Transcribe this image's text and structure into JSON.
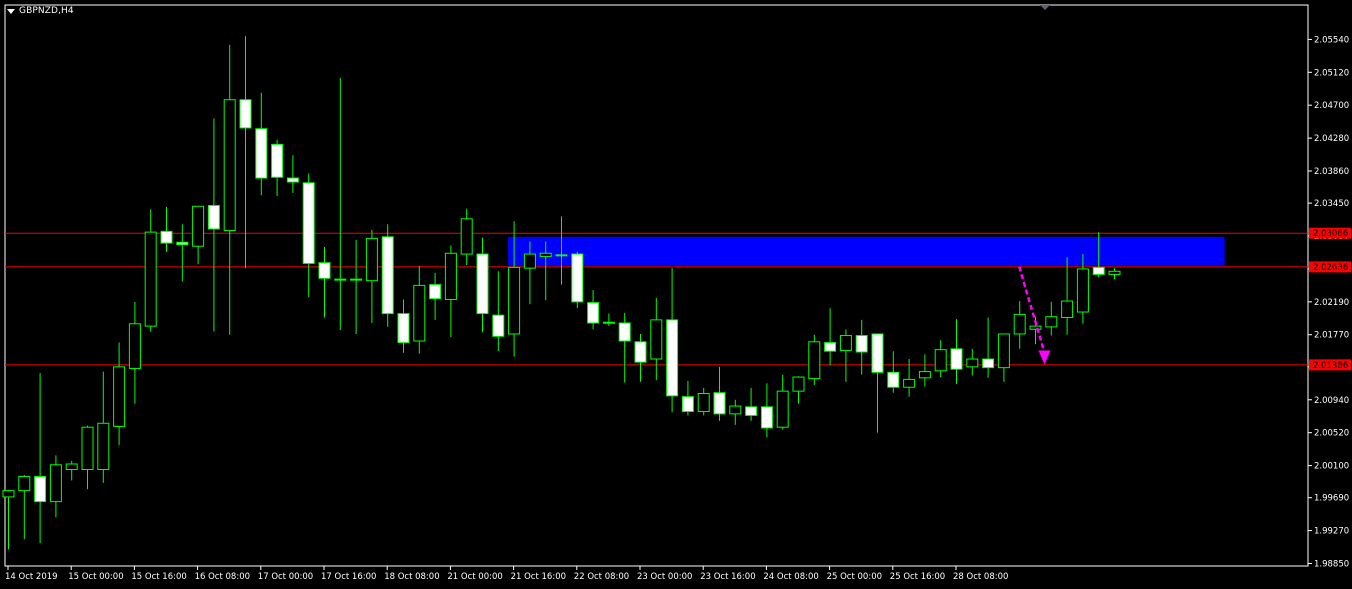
{
  "window": {
    "symbol_title": "GBPNZD,H4"
  },
  "colors": {
    "background": "#000000",
    "grid_frame": "#ffffff",
    "bull": "#00ff00",
    "bear": "#ffffff",
    "resistance_zone": "#0000ff",
    "level_line": "#ff0000",
    "projection_arrow": "#ff00ff"
  },
  "chart_data": {
    "type": "candlestick",
    "symbol": "GBPNZD",
    "timeframe": "H4",
    "ylim": [
      1.9885,
      2.0596
    ],
    "y_ticks": [
      1.9885,
      1.9927,
      1.9969,
      2.001,
      2.0052,
      2.0094,
      2.0136,
      2.0177,
      2.0219,
      2.0261,
      2.0303,
      2.0345,
      2.0386,
      2.0428,
      2.047,
      2.0512,
      2.0554
    ],
    "y_tick_labels": [
      "1.98850",
      "1.99270",
      "1.99690",
      "2.00100",
      "2.00520",
      "2.00940",
      "2.01360",
      "2.01770",
      "2.02190",
      "2.02610",
      "2.03030",
      "2.03450",
      "2.03860",
      "2.04280",
      "2.04700",
      "2.05120",
      "2.05540"
    ],
    "x_tick_labels": [
      {
        "label": "14 Oct 2019",
        "candle": 0
      },
      {
        "label": "15 Oct 00:00",
        "candle": 4
      },
      {
        "label": "15 Oct 16:00",
        "candle": 8
      },
      {
        "label": "16 Oct 08:00",
        "candle": 12
      },
      {
        "label": "17 Oct 00:00",
        "candle": 16
      },
      {
        "label": "17 Oct 16:00",
        "candle": 20
      },
      {
        "label": "18 Oct 08:00",
        "candle": 24
      },
      {
        "label": "21 Oct 00:00",
        "candle": 28
      },
      {
        "label": "21 Oct 16:00",
        "candle": 32
      },
      {
        "label": "22 Oct 08:00",
        "candle": 36
      },
      {
        "label": "23 Oct 00:00",
        "candle": 40
      },
      {
        "label": "23 Oct 16:00",
        "candle": 44
      },
      {
        "label": "24 Oct 08:00",
        "candle": 48
      },
      {
        "label": "25 Oct 00:00",
        "candle": 52
      },
      {
        "label": "25 Oct 16:00",
        "candle": 56
      },
      {
        "label": "28 Oct 08:00",
        "candle": 60
      }
    ],
    "candles": [
      {
        "o": 1.997,
        "h": 1.9979,
        "l": 1.9903,
        "c": 1.9978
      },
      {
        "o": 1.9978,
        "h": 1.9998,
        "l": 1.9916,
        "c": 1.9996
      },
      {
        "o": 1.9996,
        "h": 2.0128,
        "l": 1.9911,
        "c": 1.9964
      },
      {
        "o": 1.9964,
        "h": 2.0023,
        "l": 1.9944,
        "c": 2.0011
      },
      {
        "o": 2.0005,
        "h": 2.0016,
        "l": 1.9991,
        "c": 2.0012
      },
      {
        "o": 2.0005,
        "h": 2.0061,
        "l": 1.998,
        "c": 2.0059
      },
      {
        "o": 2.0005,
        "h": 2.013,
        "l": 1.9988,
        "c": 2.0064
      },
      {
        "o": 2.006,
        "h": 2.0167,
        "l": 2.0036,
        "c": 2.0136
      },
      {
        "o": 2.0134,
        "h": 2.0219,
        "l": 2.0089,
        "c": 2.0191
      },
      {
        "o": 2.0188,
        "h": 2.0337,
        "l": 2.0181,
        "c": 2.0308
      },
      {
        "o": 2.0309,
        "h": 2.034,
        "l": 2.0283,
        "c": 2.0294
      },
      {
        "o": 2.0295,
        "h": 2.0318,
        "l": 2.0245,
        "c": 2.0292
      },
      {
        "o": 2.029,
        "h": 2.0337,
        "l": 2.0267,
        "c": 2.0341
      },
      {
        "o": 2.0342,
        "h": 2.0453,
        "l": 2.0181,
        "c": 2.0312
      },
      {
        "o": 2.031,
        "h": 2.0547,
        "l": 2.0177,
        "c": 2.0477
      },
      {
        "o": 2.0477,
        "h": 2.0558,
        "l": 2.0262,
        "c": 2.0441
      },
      {
        "o": 2.044,
        "h": 2.0486,
        "l": 2.0355,
        "c": 2.0377
      },
      {
        "o": 2.042,
        "h": 2.0426,
        "l": 2.0354,
        "c": 2.0378
      },
      {
        "o": 2.0377,
        "h": 2.0406,
        "l": 2.0358,
        "c": 2.0372
      },
      {
        "o": 2.0371,
        "h": 2.0383,
        "l": 2.0225,
        "c": 2.0268
      },
      {
        "o": 2.0269,
        "h": 2.0289,
        "l": 2.0199,
        "c": 2.0249
      },
      {
        "o": 2.0247,
        "h": 2.0505,
        "l": 2.0183,
        "c": 2.0248
      },
      {
        "o": 2.0247,
        "h": 2.0298,
        "l": 2.0178,
        "c": 2.0248
      },
      {
        "o": 2.0246,
        "h": 2.0311,
        "l": 2.0192,
        "c": 2.03
      },
      {
        "o": 2.0302,
        "h": 2.0318,
        "l": 2.0187,
        "c": 2.0204
      },
      {
        "o": 2.0204,
        "h": 2.0222,
        "l": 2.0154,
        "c": 2.0167
      },
      {
        "o": 2.0169,
        "h": 2.0265,
        "l": 2.0153,
        "c": 2.024
      },
      {
        "o": 2.0241,
        "h": 2.0256,
        "l": 2.0196,
        "c": 2.0223
      },
      {
        "o": 2.0222,
        "h": 2.0291,
        "l": 2.0174,
        "c": 2.0281
      },
      {
        "o": 2.028,
        "h": 2.0338,
        "l": 2.0266,
        "c": 2.0325
      },
      {
        "o": 2.028,
        "h": 2.0301,
        "l": 2.018,
        "c": 2.0204
      },
      {
        "o": 2.0202,
        "h": 2.0258,
        "l": 2.0156,
        "c": 2.0175
      },
      {
        "o": 2.0178,
        "h": 2.0322,
        "l": 2.0149,
        "c": 2.0263
      },
      {
        "o": 2.0262,
        "h": 2.0296,
        "l": 2.0216,
        "c": 2.028
      },
      {
        "o": 2.0277,
        "h": 2.0296,
        "l": 2.0221,
        "c": 2.0281
      },
      {
        "o": 2.0279,
        "h": 2.0328,
        "l": 2.0241,
        "c": 2.0279
      },
      {
        "o": 2.028,
        "h": 2.0283,
        "l": 2.0211,
        "c": 2.0219
      },
      {
        "o": 2.0218,
        "h": 2.0234,
        "l": 2.0184,
        "c": 2.0192
      },
      {
        "o": 2.0192,
        "h": 2.0204,
        "l": 2.0188,
        "c": 2.0193
      },
      {
        "o": 2.0192,
        "h": 2.0205,
        "l": 2.0116,
        "c": 2.0169
      },
      {
        "o": 2.0168,
        "h": 2.0178,
        "l": 2.0117,
        "c": 2.0142
      },
      {
        "o": 2.0146,
        "h": 2.0224,
        "l": 2.0119,
        "c": 2.0196
      },
      {
        "o": 2.0196,
        "h": 2.0262,
        "l": 2.0078,
        "c": 2.0099
      },
      {
        "o": 2.0098,
        "h": 2.0118,
        "l": 2.0074,
        "c": 2.0079
      },
      {
        "o": 2.0079,
        "h": 2.0109,
        "l": 2.0074,
        "c": 2.0102
      },
      {
        "o": 2.0103,
        "h": 2.0136,
        "l": 2.0067,
        "c": 2.0076
      },
      {
        "o": 2.0076,
        "h": 2.0094,
        "l": 2.0062,
        "c": 2.0086
      },
      {
        "o": 2.0085,
        "h": 2.0109,
        "l": 2.0067,
        "c": 2.0074
      },
      {
        "o": 2.0085,
        "h": 2.0115,
        "l": 2.0046,
        "c": 2.0058
      },
      {
        "o": 2.0059,
        "h": 2.0126,
        "l": 2.0056,
        "c": 2.0105
      },
      {
        "o": 2.0105,
        "h": 2.0124,
        "l": 2.0089,
        "c": 2.0123
      },
      {
        "o": 2.0121,
        "h": 2.0177,
        "l": 2.0113,
        "c": 2.0168
      },
      {
        "o": 2.0167,
        "h": 2.0211,
        "l": 2.0138,
        "c": 2.0156
      },
      {
        "o": 2.0157,
        "h": 2.0184,
        "l": 2.0117,
        "c": 2.0176
      },
      {
        "o": 2.0176,
        "h": 2.0196,
        "l": 2.0126,
        "c": 2.0155
      },
      {
        "o": 2.0178,
        "h": 2.0178,
        "l": 2.0052,
        "c": 2.0129
      },
      {
        "o": 2.0129,
        "h": 2.0156,
        "l": 2.0103,
        "c": 2.011
      },
      {
        "o": 2.011,
        "h": 2.0146,
        "l": 2.0098,
        "c": 2.012
      },
      {
        "o": 2.0122,
        "h": 2.0152,
        "l": 2.0111,
        "c": 2.013
      },
      {
        "o": 2.0131,
        "h": 2.017,
        "l": 2.0123,
        "c": 2.0158
      },
      {
        "o": 2.0159,
        "h": 2.0197,
        "l": 2.0114,
        "c": 2.0133
      },
      {
        "o": 2.0136,
        "h": 2.0159,
        "l": 2.0125,
        "c": 2.0146
      },
      {
        "o": 2.0146,
        "h": 2.0199,
        "l": 2.0122,
        "c": 2.0135
      },
      {
        "o": 2.0135,
        "h": 2.0177,
        "l": 2.0117,
        "c": 2.0178
      },
      {
        "o": 2.0178,
        "h": 2.022,
        "l": 2.0159,
        "c": 2.0203
      },
      {
        "o": 2.0184,
        "h": 2.02,
        "l": 2.0165,
        "c": 2.0188
      },
      {
        "o": 2.0187,
        "h": 2.0219,
        "l": 2.0176,
        "c": 2.02
      },
      {
        "o": 2.0199,
        "h": 2.0276,
        "l": 2.0177,
        "c": 2.022
      },
      {
        "o": 2.0206,
        "h": 2.028,
        "l": 2.0191,
        "c": 2.0261
      },
      {
        "o": 2.0263,
        "h": 2.0308,
        "l": 2.025,
        "c": 2.0254
      },
      {
        "o": 2.0254,
        "h": 2.0262,
        "l": 2.0248,
        "c": 2.0258
      }
    ],
    "levels": [
      {
        "price": 2.03066,
        "label": "2.03066"
      },
      {
        "price": 2.02636,
        "label": "2.02636"
      },
      {
        "price": 2.01386,
        "label": "2.01386"
      }
    ],
    "zone": {
      "from_candle": 32,
      "to_candle": 77,
      "top": 2.0302,
      "bottom": 2.0265
    },
    "projection": {
      "from_candle": 64,
      "from_price": 2.0264,
      "to_candle": 65.6,
      "to_price": 2.0139
    }
  }
}
